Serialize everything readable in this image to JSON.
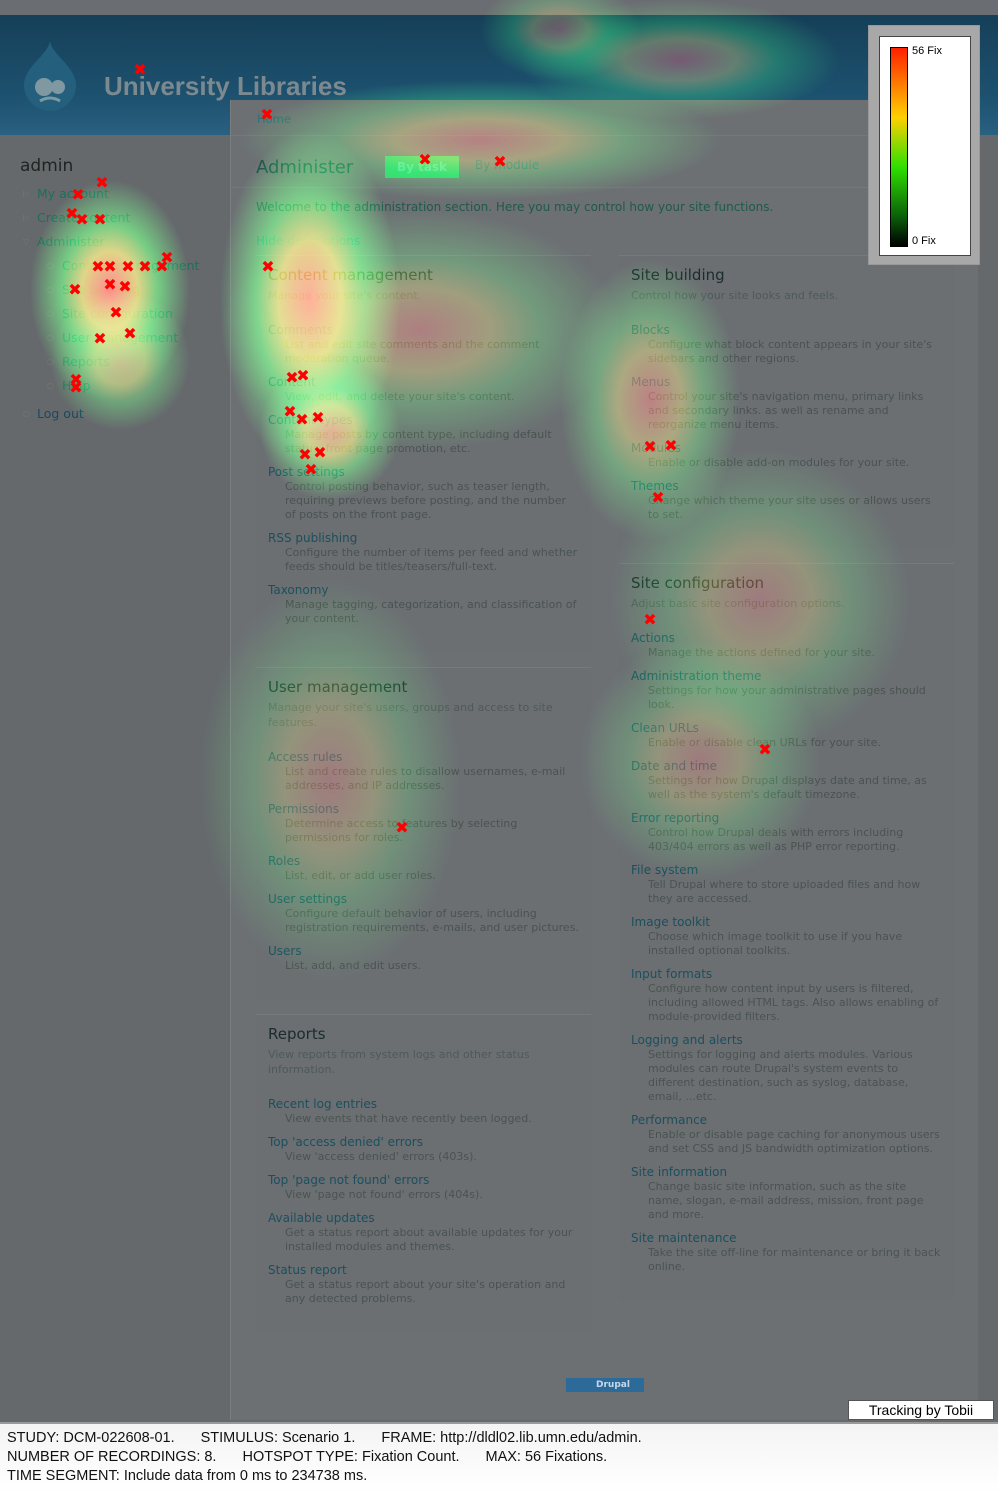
{
  "header": {
    "site_name": "University Libraries",
    "logo": "drupal-drop-icon"
  },
  "breadcrumb": "Home",
  "sidebar": {
    "title": "admin",
    "items": [
      {
        "label": "My account",
        "level": 1
      },
      {
        "label": "Create content",
        "level": 1
      },
      {
        "label": "Administer",
        "level": 1,
        "expanded": true
      },
      {
        "label": "Content management",
        "level": 2
      },
      {
        "label": "Site building",
        "level": 2
      },
      {
        "label": "Site configuration",
        "level": 2
      },
      {
        "label": "User management",
        "level": 2
      },
      {
        "label": "Reports",
        "level": 2
      },
      {
        "label": "Help",
        "level": 2
      },
      {
        "label": "Log out",
        "level": 0
      }
    ]
  },
  "page": {
    "title": "Administer",
    "tabs": [
      {
        "label": "By task",
        "active": true
      },
      {
        "label": "By module",
        "active": false
      }
    ],
    "welcome": "Welcome to the administration section. Here you may control how your site functions.",
    "hide_descriptions": "Hide descriptions"
  },
  "left_sections": [
    {
      "title": "Content management",
      "desc": "Manage your site's content.",
      "items": [
        {
          "t": "Comments",
          "d": "List and edit site comments and the comment moderation queue."
        },
        {
          "t": "Content",
          "d": "View, edit, and delete your site's content."
        },
        {
          "t": "Content types",
          "d": "Manage posts by content type, including default status, front page promotion, etc."
        },
        {
          "t": "Post settings",
          "d": "Control posting behavior, such as teaser length, requiring previews before posting, and the number of posts on the front page."
        },
        {
          "t": "RSS publishing",
          "d": "Configure the number of items per feed and whether feeds should be titles/teasers/full-text."
        },
        {
          "t": "Taxonomy",
          "d": "Manage tagging, categorization, and classification of your content."
        }
      ]
    },
    {
      "title": "User management",
      "desc": "Manage your site's users, groups and access to site features.",
      "items": [
        {
          "t": "Access rules",
          "d": "List and create rules to disallow usernames, e-mail addresses, and IP addresses."
        },
        {
          "t": "Permissions",
          "d": "Determine access to features by selecting permissions for roles."
        },
        {
          "t": "Roles",
          "d": "List, edit, or add user roles."
        },
        {
          "t": "User settings",
          "d": "Configure default behavior of users, including registration requirements, e-mails, and user pictures."
        },
        {
          "t": "Users",
          "d": "List, add, and edit users."
        }
      ]
    },
    {
      "title": "Reports",
      "desc": "View reports from system logs and other status information.",
      "items": [
        {
          "t": "Recent log entries",
          "d": "View events that have recently been logged."
        },
        {
          "t": "Top 'access denied' errors",
          "d": "View 'access denied' errors (403s)."
        },
        {
          "t": "Top 'page not found' errors",
          "d": "View 'page not found' errors (404s)."
        },
        {
          "t": "Available updates",
          "d": "Get a status report about available updates for your installed modules and themes."
        },
        {
          "t": "Status report",
          "d": "Get a status report about your site's operation and any detected problems."
        }
      ]
    }
  ],
  "right_sections": [
    {
      "title": "Site building",
      "desc": "Control how your site looks and feels.",
      "items": [
        {
          "t": "Blocks",
          "d": "Configure what block content appears in your site's sidebars and other regions."
        },
        {
          "t": "Menus",
          "d": "Control your site's navigation menu, primary links and secondary links. as well as rename and reorganize menu items."
        },
        {
          "t": "Modules",
          "d": "Enable or disable add-on modules for your site."
        },
        {
          "t": "Themes",
          "d": "Change which theme your site uses or allows users to set."
        }
      ]
    },
    {
      "title": "Site configuration",
      "desc": "Adjust basic site configuration options.",
      "items": [
        {
          "t": "Actions",
          "d": "Manage the actions defined for your site."
        },
        {
          "t": "Administration theme",
          "d": "Settings for how your administrative pages should look."
        },
        {
          "t": "Clean URLs",
          "d": "Enable or disable clean URLs for your site."
        },
        {
          "t": "Date and time",
          "d": "Settings for how Drupal displays date and time, as well as the system's default timezone."
        },
        {
          "t": "Error reporting",
          "d": "Control how Drupal deals with errors including 403/404 errors as well as PHP error reporting."
        },
        {
          "t": "File system",
          "d": "Tell Drupal where to store uploaded files and how they are accessed."
        },
        {
          "t": "Image toolkit",
          "d": "Choose which image toolkit to use if you have installed optional toolkits."
        },
        {
          "t": "Input formats",
          "d": "Configure how content input by users is filtered, including allowed HTML tags. Also allows enabling of module-provided filters."
        },
        {
          "t": "Logging and alerts",
          "d": "Settings for logging and alerts modules. Various modules can route Drupal's system events to different destination, such as syslog, database, email, ...etc."
        },
        {
          "t": "Performance",
          "d": "Enable or disable page caching for anonymous users and set CSS and JS bandwidth optimization options."
        },
        {
          "t": "Site information",
          "d": "Change basic site information, such as the site name, slogan, e-mail address, mission, front page and more."
        },
        {
          "t": "Site maintenance",
          "d": "Take the site off-line for maintenance or bring it back online."
        }
      ]
    }
  ],
  "drupal_badge": "Drupal",
  "legend": {
    "max": "56 Fix",
    "min": "0 Fix",
    "colors": [
      "#ff2000",
      "#ffd000",
      "#30e000",
      "#000000"
    ]
  },
  "tobii": "Tracking by Tobii",
  "footer": {
    "line1": [
      "STUDY: DCM-022608-01.",
      "STIMULUS: Scenario 1.",
      "FRAME: http://dldl02.lib.umn.edu/admin."
    ],
    "line2": [
      "NUMBER OF RECORDINGS: 8.",
      "HOTSPOT TYPE: Fixation Count.",
      "MAX: 56 Fixations."
    ],
    "line3": [
      "TIME SEGMENT: Include data from 0 ms to 234738 ms."
    ]
  }
}
